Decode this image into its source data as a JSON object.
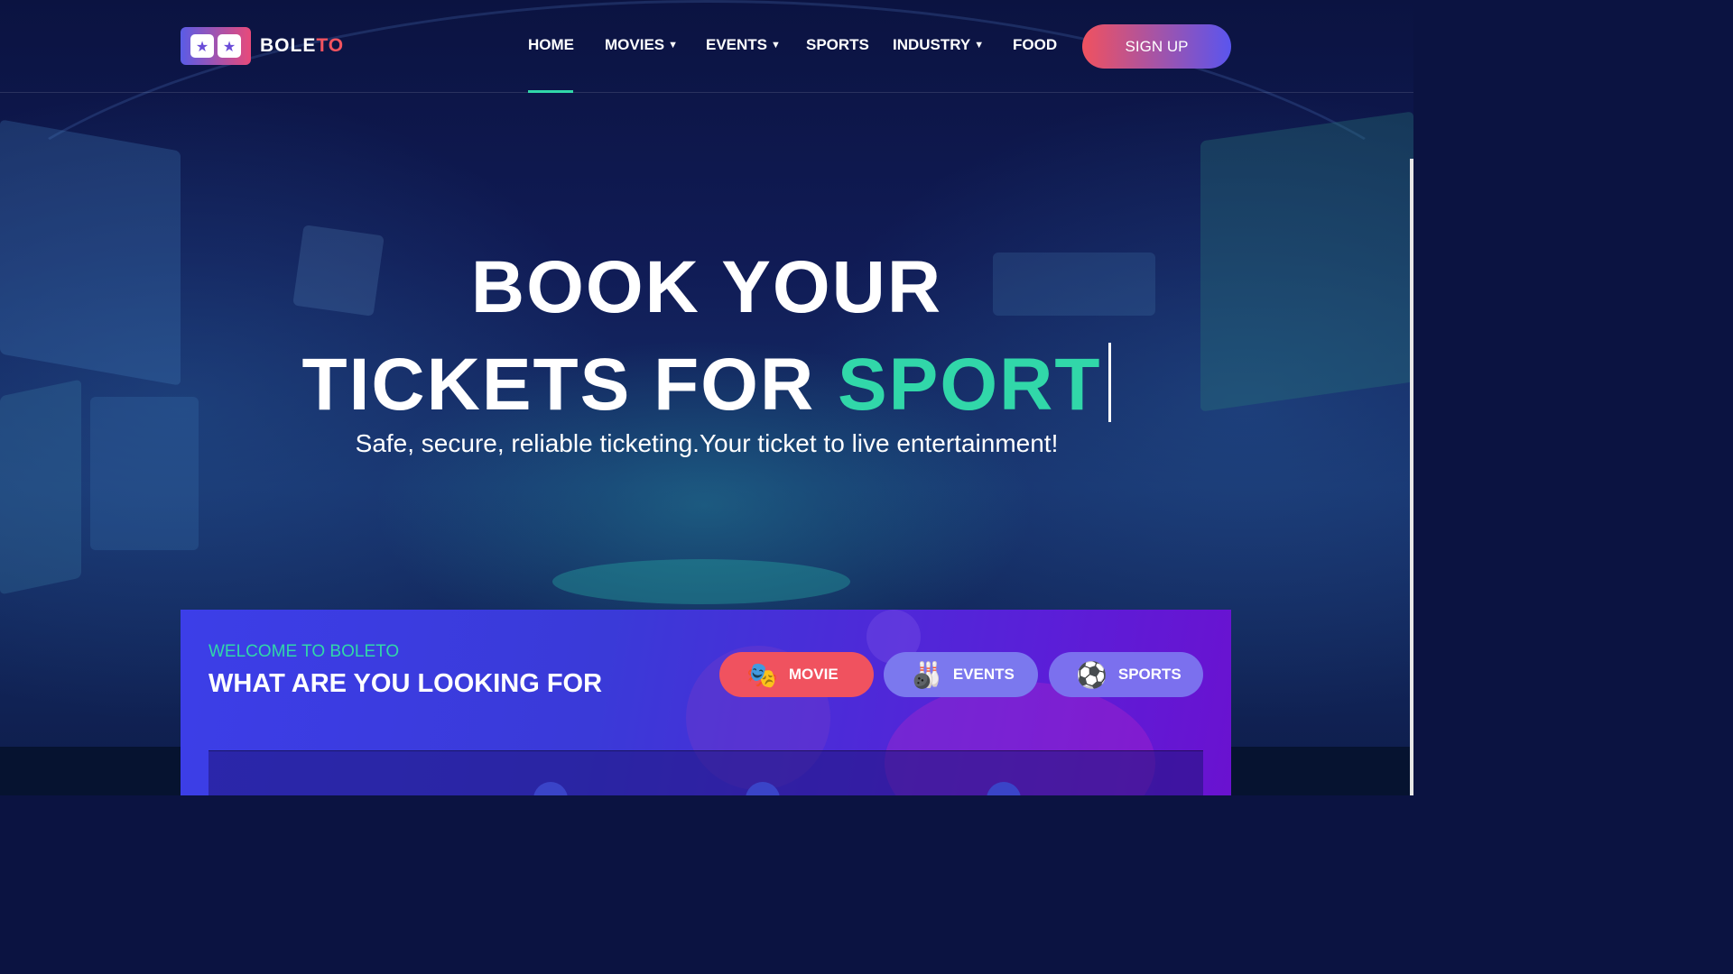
{
  "brand": {
    "name_part1": "BOLE",
    "name_part2": "TO",
    "logo_icon": "ticket-icon",
    "accent": "#f2535f"
  },
  "nav": {
    "items": [
      {
        "label": "HOME",
        "has_dropdown": false,
        "active": true
      },
      {
        "label": "MOVIES",
        "has_dropdown": true
      },
      {
        "label": "EVENTS",
        "has_dropdown": true
      },
      {
        "label": "SPORTS",
        "has_dropdown": false
      },
      {
        "label": "INDUSTRY",
        "has_dropdown": true
      },
      {
        "label": "FOOD",
        "has_dropdown": false
      }
    ],
    "signup_label": "SIGN UP"
  },
  "hero": {
    "line1": "BOOK YOUR",
    "line2_prefix": "TICKETS FOR",
    "line2_accent": "SPORT",
    "subtitle": "Safe, secure, reliable ticketing.Your ticket to live entertainment!",
    "accent_color": "#31d7a9"
  },
  "search": {
    "welcome": "WELCOME TO BOLETO",
    "heading": "WHAT ARE YOU LOOKING FOR",
    "categories": [
      {
        "label": "MOVIE",
        "icon": "theater-masks-icon",
        "color": "#f0525f"
      },
      {
        "label": "EVENTS",
        "icon": "bowling-icon",
        "color": "#7b78ee"
      },
      {
        "label": "SPORTS",
        "icon": "soccer-ball-icon",
        "color": "#7b70ee"
      }
    ]
  }
}
